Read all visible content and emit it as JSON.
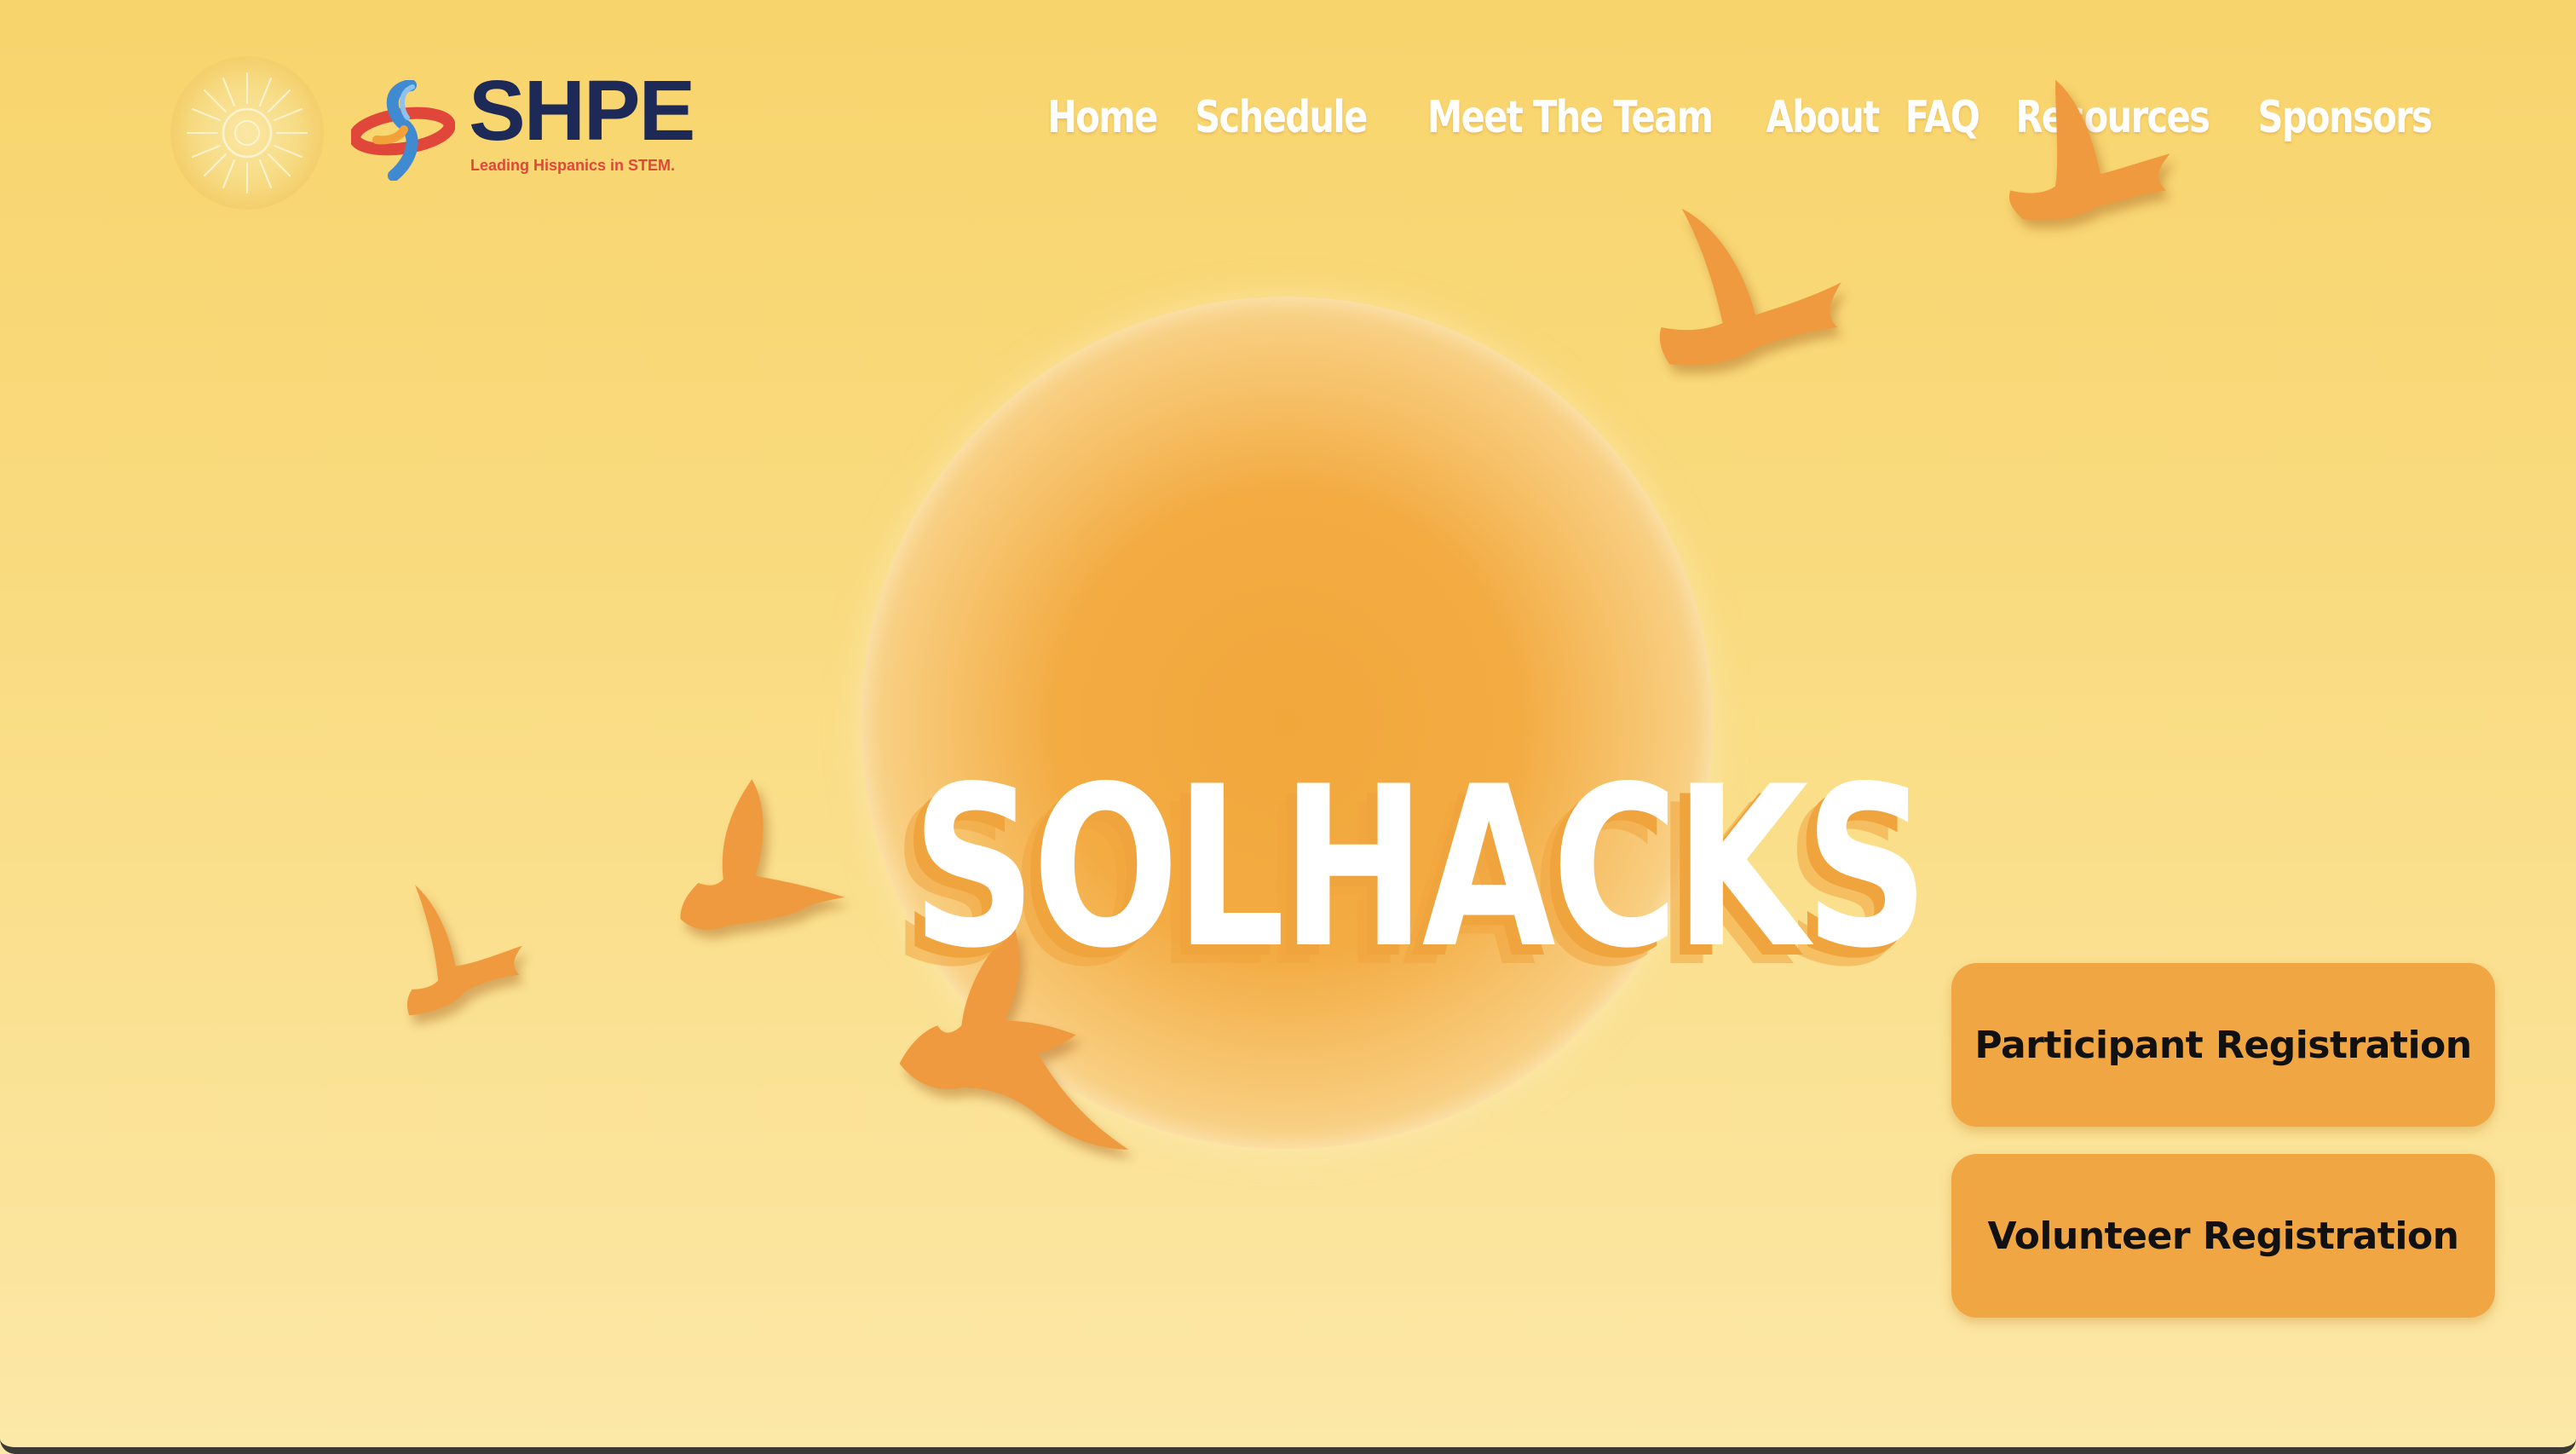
{
  "header": {
    "sun_logo_icon": "sun-emblem-icon",
    "brand": {
      "name": "SHPE",
      "tagline": "Leading Hispanics in STEM."
    },
    "nav": [
      {
        "label": "Home"
      },
      {
        "label": "Schedule"
      },
      {
        "label": "Meet The Team"
      },
      {
        "label": "About"
      },
      {
        "label": "FAQ"
      },
      {
        "label": "Resources"
      },
      {
        "label": "Sponsors"
      }
    ]
  },
  "hero": {
    "title": "SOLHACKS",
    "decoration": "bird-icon"
  },
  "buttons": {
    "participant": "Participant Registration",
    "volunteer": "Volunteer Registration"
  },
  "colors": {
    "background": "#f8d46c",
    "accent": "#f0a642",
    "bird": "#ef9a3e",
    "brand_navy": "#1d2a57",
    "brand_red": "#e0473a"
  }
}
